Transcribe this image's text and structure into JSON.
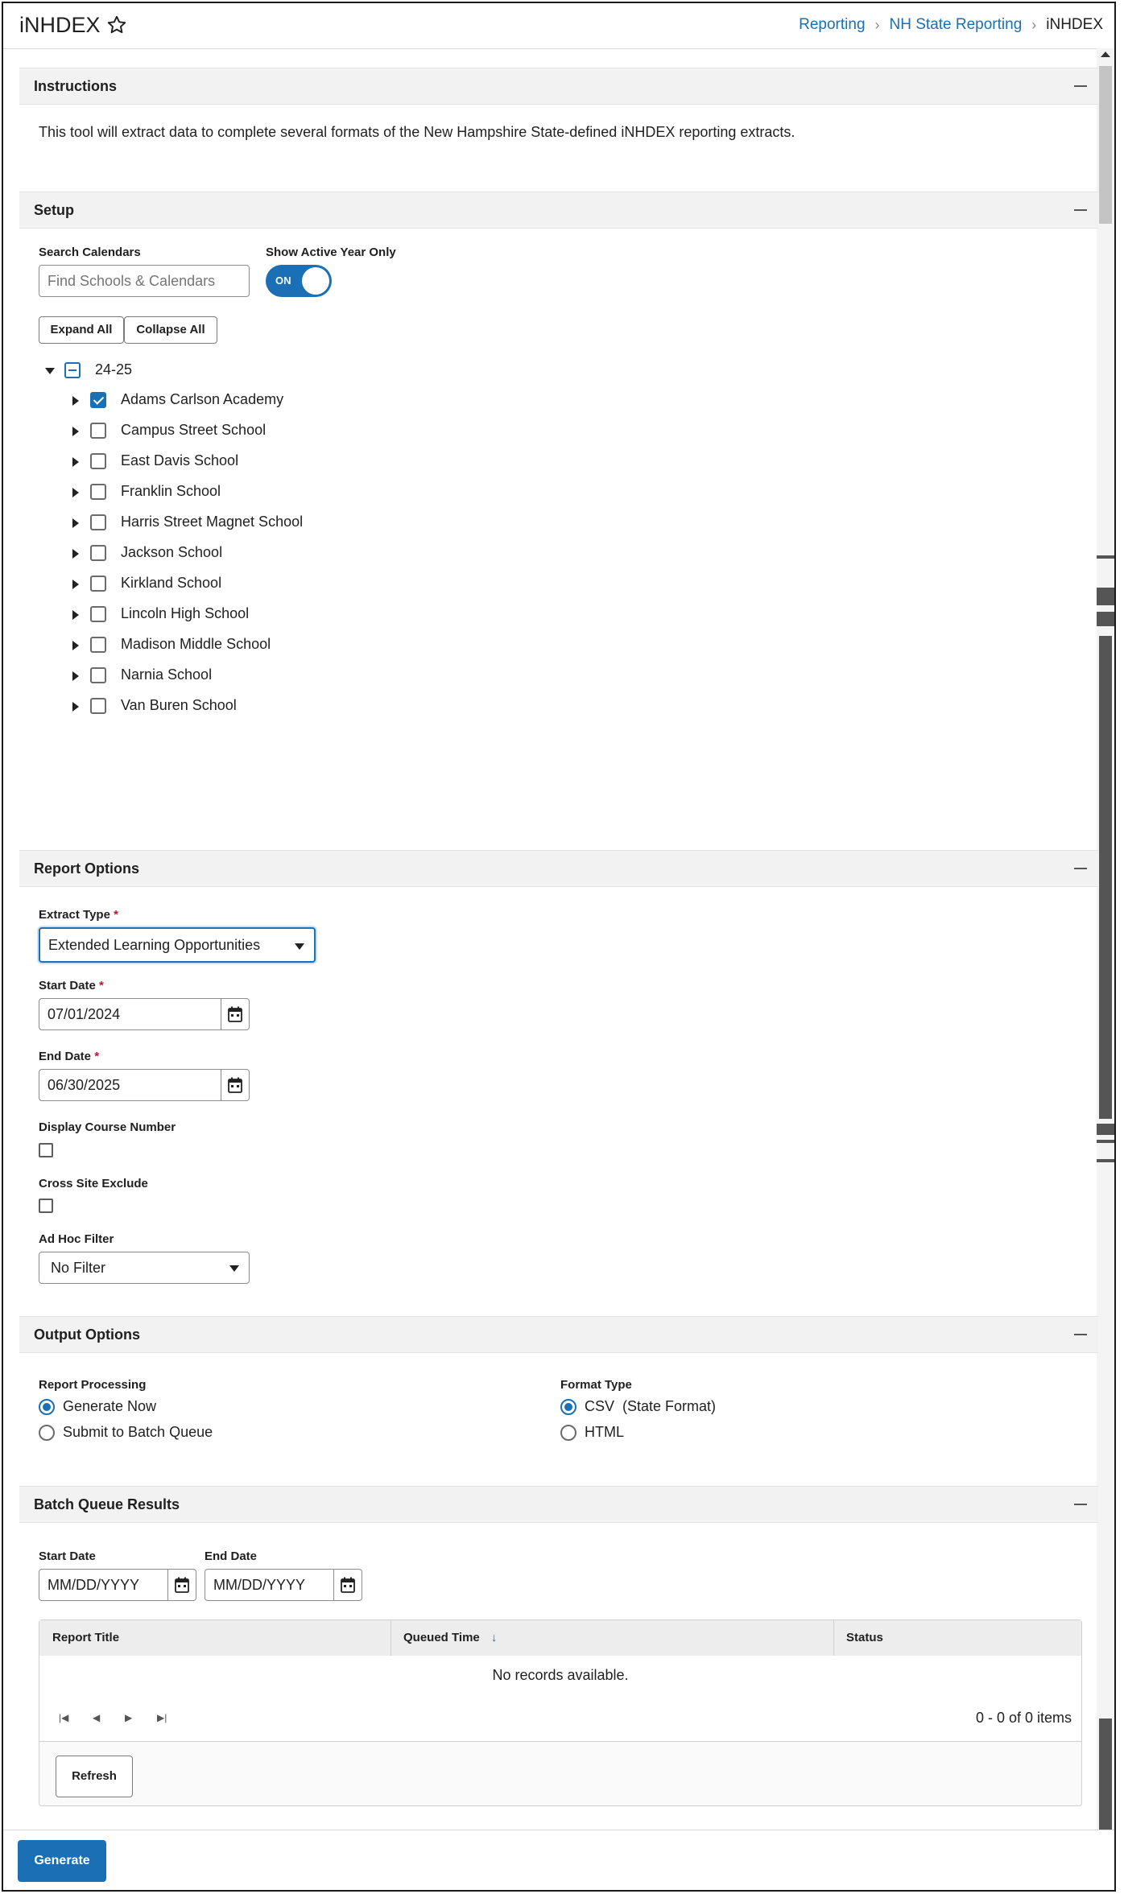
{
  "app": {
    "title": "iNHDEX"
  },
  "breadcrumb": {
    "items": [
      "Reporting",
      "NH State Reporting"
    ],
    "current": "iNHDEX"
  },
  "sections": {
    "instructions": {
      "title": "Instructions",
      "text": "This tool will extract data to complete several formats of the New Hampshire State-defined iNHDEX reporting extracts."
    },
    "setup": {
      "title": "Setup",
      "search_label": "Search Calendars",
      "search_placeholder": "Find Schools & Calendars",
      "active_year_label": "Show Active Year Only",
      "toggle_text": "ON",
      "expand_all": "Expand All",
      "collapse_all": "Collapse All",
      "year": "24-25",
      "schools": [
        {
          "name": "Adams Carlson Academy",
          "checked": true
        },
        {
          "name": "Campus Street School",
          "checked": false
        },
        {
          "name": "East Davis School",
          "checked": false
        },
        {
          "name": "Franklin School",
          "checked": false
        },
        {
          "name": "Harris Street Magnet School",
          "checked": false
        },
        {
          "name": "Jackson School",
          "checked": false
        },
        {
          "name": "Kirkland School",
          "checked": false
        },
        {
          "name": "Lincoln High School",
          "checked": false
        },
        {
          "name": "Madison Middle School",
          "checked": false
        },
        {
          "name": "Narnia School",
          "checked": false
        },
        {
          "name": "Van Buren School",
          "checked": false
        }
      ]
    },
    "report_options": {
      "title": "Report Options",
      "extract_type_label": "Extract Type",
      "extract_type_value": "Extended Learning Opportunities",
      "start_date_label": "Start Date",
      "start_date_value": "07/01/2024",
      "end_date_label": "End Date",
      "end_date_value": "06/30/2025",
      "display_course_label": "Display Course Number",
      "cross_site_label": "Cross Site Exclude",
      "ad_hoc_label": "Ad Hoc Filter",
      "ad_hoc_value": "No Filter",
      "required_mark": "*"
    },
    "output_options": {
      "title": "Output Options",
      "processing_label": "Report Processing",
      "generate_now": "Generate Now",
      "submit_batch": "Submit to Batch Queue",
      "format_label": "Format Type",
      "csv": "CSV  (State Format)",
      "html": "HTML"
    },
    "batch_queue": {
      "title": "Batch Queue Results",
      "start_label": "Start Date",
      "start_placeholder": "MM/DD/YYYY",
      "end_label": "End Date",
      "end_placeholder": "MM/DD/YYYY",
      "columns": [
        "Report Title",
        "Queued Time",
        "Status"
      ],
      "sort_arrow": "↓",
      "empty_text": "No records available.",
      "pager_count": "0 - 0 of 0 items",
      "refresh": "Refresh"
    }
  },
  "footer": {
    "generate": "Generate"
  },
  "colors": {
    "accent": "#1a6fb5",
    "required": "#c8102e"
  },
  "icons": [
    "star-icon",
    "chevron-right-icon",
    "calendar-icon",
    "caret-down-icon",
    "first-page-icon",
    "prev-page-icon",
    "next-page-icon",
    "last-page-icon"
  ]
}
